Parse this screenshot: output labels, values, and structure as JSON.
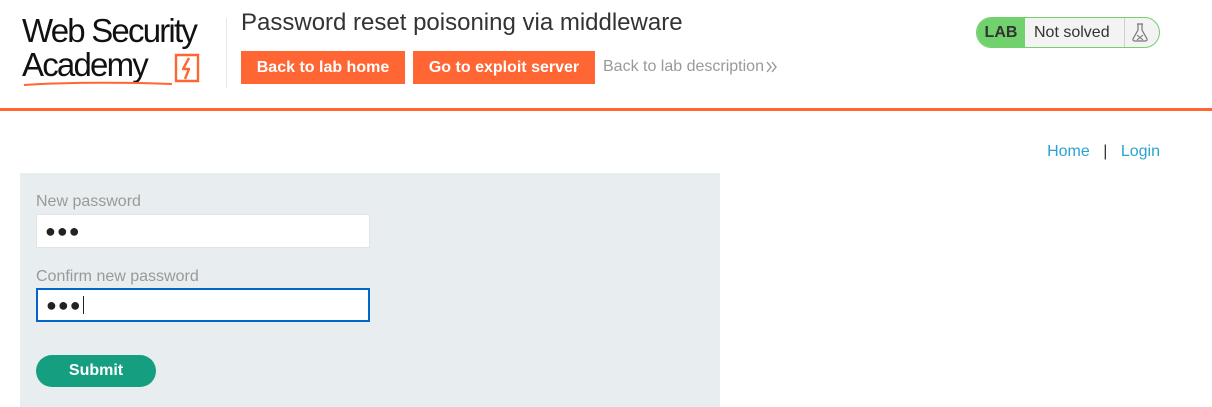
{
  "header": {
    "logo": {
      "line1": "Web Security",
      "line2": "Academy"
    },
    "lab_title": "Password reset poisoning via middleware",
    "back_to_lab_home": "Back to lab home",
    "go_to_exploit_server": "Go to exploit server",
    "back_to_lab_description": "Back to lab description",
    "status_badge": "LAB",
    "status_text": "Not solved",
    "accent_color": "#ff6633",
    "status_color": "#70d16d"
  },
  "nav": {
    "home": "Home",
    "separator": "|",
    "login": "Login",
    "link_color": "#29a3d1"
  },
  "form": {
    "new_password_label": "New password",
    "new_password_value": "●●●",
    "confirm_password_label": "Confirm new password",
    "confirm_password_value": "●●●",
    "submit_label": "Submit",
    "submit_color": "#159e80"
  }
}
